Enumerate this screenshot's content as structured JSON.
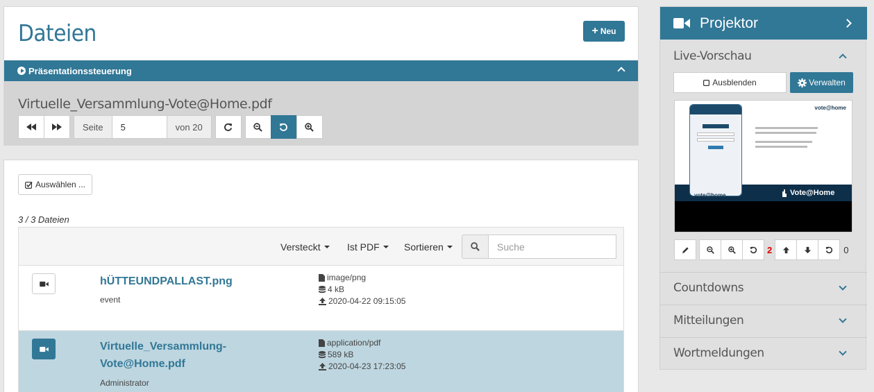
{
  "header": {
    "title": "Dateien",
    "new_button": "Neu"
  },
  "presentation": {
    "bar_title": "Präsentationssteuerung",
    "file_name": "Virtuelle_Versammlung-Vote@Home.pdf",
    "page_label": "Seite",
    "page_value": "5",
    "total_label": "von 20"
  },
  "files": {
    "select_button": "Auswählen ...",
    "count_text": "3 / 3 Dateien",
    "filters": {
      "hidden": "Versteckt",
      "is_pdf": "Ist PDF",
      "sort": "Sortieren"
    },
    "search_placeholder": "Suche",
    "rows": [
      {
        "name": "hÜTTEUNDPALLAST.png",
        "owner": "event",
        "mime": "image/png",
        "size": "4 kB",
        "date": "2020-04-22 09:15:05"
      },
      {
        "name_line1": "Virtuelle_Versammlung-",
        "name_line2": "Vote@Home.pdf",
        "owner": "Administrator",
        "mime": "application/pdf",
        "size": "589 kB",
        "date": "2020-04-23 17:23:05"
      }
    ]
  },
  "projector": {
    "title": "Projektor",
    "live_preview": "Live-Vorschau",
    "hide_button": "Ausblenden",
    "manage_button": "Verwalten",
    "zoom_value": "2",
    "scroll_value": "0",
    "preview_logo": "Vote@Home",
    "preview_brand": "vote@home",
    "sections": [
      "Countdowns",
      "Mitteilungen",
      "Wortmeldungen"
    ]
  },
  "colors": {
    "primary": "#317796",
    "selected_row": "#bed6e0",
    "zoom_counter": "#e00000"
  }
}
